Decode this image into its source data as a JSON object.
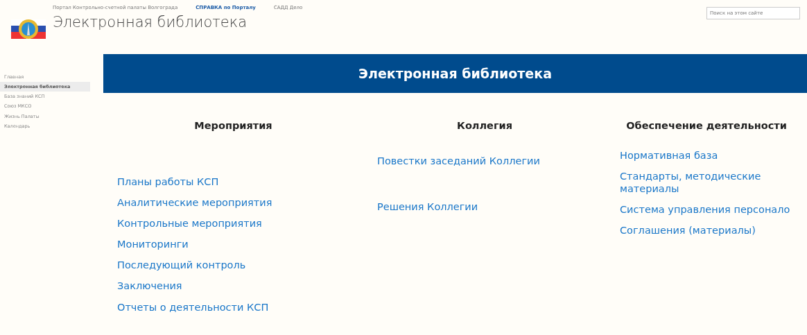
{
  "top_links": [
    {
      "label": "Портал Контрольно-счетной палаты Волгограда",
      "kind": "plain"
    },
    {
      "label": "СПРАВКА по Порталу",
      "kind": "strong"
    },
    {
      "label": "САДД Дело",
      "kind": "plain"
    }
  ],
  "site_title": "Электронная библиотека",
  "search": {
    "placeholder": "Поиск на этом сайте"
  },
  "sidebar": {
    "items": [
      {
        "label": "Главная",
        "selected": false
      },
      {
        "label": "Электронная библиотека",
        "selected": true
      },
      {
        "label": "База знаний КСП",
        "selected": false
      },
      {
        "label": "Союз МКСО",
        "selected": false
      },
      {
        "label": "Жизнь Палаты",
        "selected": false
      },
      {
        "label": "Календарь",
        "selected": false
      }
    ]
  },
  "banner": "Электронная библиотека",
  "columns": [
    {
      "heading": "Мероприятия",
      "links": [
        "Планы работы КСП",
        "Аналитические мероприятия",
        "Контрольные мероприятия",
        "Мониторинги",
        "Последующий контроль",
        "Заключения",
        "Отчеты о деятельности КСП"
      ]
    },
    {
      "heading": "Коллегия",
      "links": [
        "Повестки заседаний Коллегии",
        "Решения Коллегии"
      ]
    },
    {
      "heading": "Обеспечение деятельности",
      "links": [
        "Нормативная база",
        "Стандарты, методические материалы",
        "Система управления персонало",
        "Соглашения (материалы)"
      ]
    }
  ]
}
